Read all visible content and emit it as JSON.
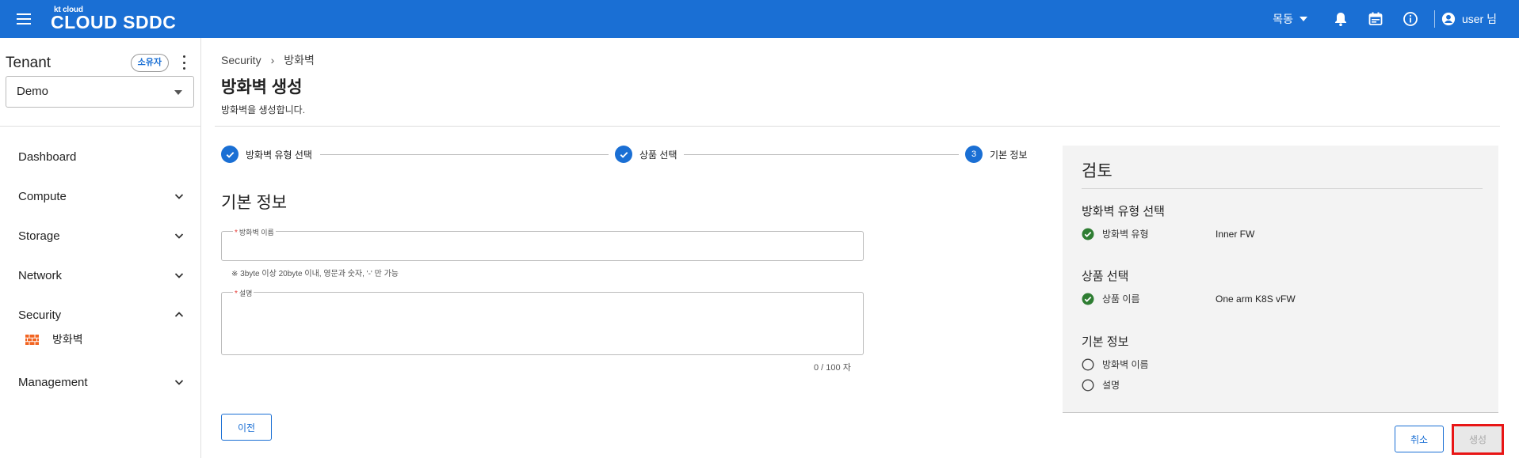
{
  "topbar": {
    "logo_small": "kt cloud",
    "logo_big": "CLOUD SDDC",
    "region": "목동",
    "user": "user 님"
  },
  "sidebar": {
    "tenant_title": "Tenant",
    "owner_badge": "소유자",
    "tenant_selected": "Demo",
    "items": [
      {
        "label": "Dashboard"
      },
      {
        "label": "Compute"
      },
      {
        "label": "Storage"
      },
      {
        "label": "Network"
      },
      {
        "label": "Security"
      },
      {
        "label": "Management"
      }
    ],
    "security_sub": "방화벽"
  },
  "breadcrumb": {
    "parent": "Security",
    "separator": "›",
    "current": "방화벽"
  },
  "page": {
    "title": "방화벽 생성",
    "description": "방화벽을 생성합니다."
  },
  "stepper": {
    "steps": [
      {
        "label": "방화벽 유형 선택",
        "state": "done"
      },
      {
        "label": "상품 선택",
        "state": "done"
      },
      {
        "label": "기본 정보",
        "state": "active",
        "number": "3"
      }
    ]
  },
  "form": {
    "section_title": "기본 정보",
    "name_label": "방화벽 이름",
    "name_value": "",
    "name_hint": "※ 3byte 이상 20byte 이내, 영문과 숫자, '-' 만 가능",
    "desc_label": "설명",
    "desc_value": "",
    "desc_counter": "0 / 100 자",
    "required_mark": "*",
    "prev_button": "이전"
  },
  "review": {
    "title": "검토",
    "sections": [
      {
        "title": "방화벽 유형 선택",
        "rows": [
          {
            "key": "방화벽 유형",
            "value": "Inner FW",
            "done": true
          }
        ]
      },
      {
        "title": "상품 선택",
        "rows": [
          {
            "key": "상품 이름",
            "value": "One arm K8S vFW",
            "done": true
          }
        ]
      },
      {
        "title": "기본 정보",
        "rows": [
          {
            "key": "방화벽 이름",
            "value": "",
            "done": false
          },
          {
            "key": "설명",
            "value": "",
            "done": false
          }
        ]
      }
    ]
  },
  "footer": {
    "cancel_button": "취소",
    "create_button": "생성"
  },
  "colors": {
    "primary": "#1a6fd4",
    "success": "#2e7d32",
    "highlight": "#e81515"
  }
}
